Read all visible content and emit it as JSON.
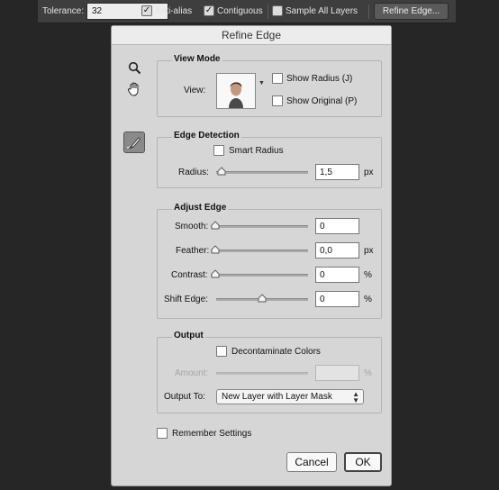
{
  "options_bar": {
    "tolerance_label": "Tolerance:",
    "tolerance_value": "32",
    "anti_alias_label": "Anti-alias",
    "anti_alias_checked": true,
    "contiguous_label": "Contiguous",
    "contiguous_checked": true,
    "sample_all_layers_label": "Sample All Layers",
    "sample_all_layers_checked": false,
    "refine_edge_button": "Refine Edge..."
  },
  "dialog": {
    "title": "Refine Edge",
    "tools": [
      "zoom-icon",
      "hand-icon",
      "refine-radius-brush-icon"
    ],
    "view_mode": {
      "title": "View Mode",
      "view_label": "View:",
      "show_radius_label": "Show Radius (J)",
      "show_original_label": "Show Original (P)"
    },
    "edge_detection": {
      "title": "Edge Detection",
      "smart_radius_label": "Smart Radius",
      "radius_label": "Radius:",
      "radius_value": "1,5",
      "radius_unit": "px"
    },
    "adjust_edge": {
      "title": "Adjust Edge",
      "smooth_label": "Smooth:",
      "smooth_value": "0",
      "feather_label": "Feather:",
      "feather_value": "0,0",
      "feather_unit": "px",
      "contrast_label": "Contrast:",
      "contrast_value": "0",
      "contrast_unit": "%",
      "shift_edge_label": "Shift Edge:",
      "shift_edge_value": "0",
      "shift_edge_unit": "%"
    },
    "output": {
      "title": "Output",
      "decontaminate_label": "Decontaminate Colors",
      "amount_label": "Amount:",
      "amount_unit": "%",
      "output_to_label": "Output To:",
      "output_to_value": "New Layer with Layer Mask"
    },
    "remember_settings_label": "Remember Settings",
    "cancel_button": "Cancel",
    "ok_button": "OK"
  }
}
